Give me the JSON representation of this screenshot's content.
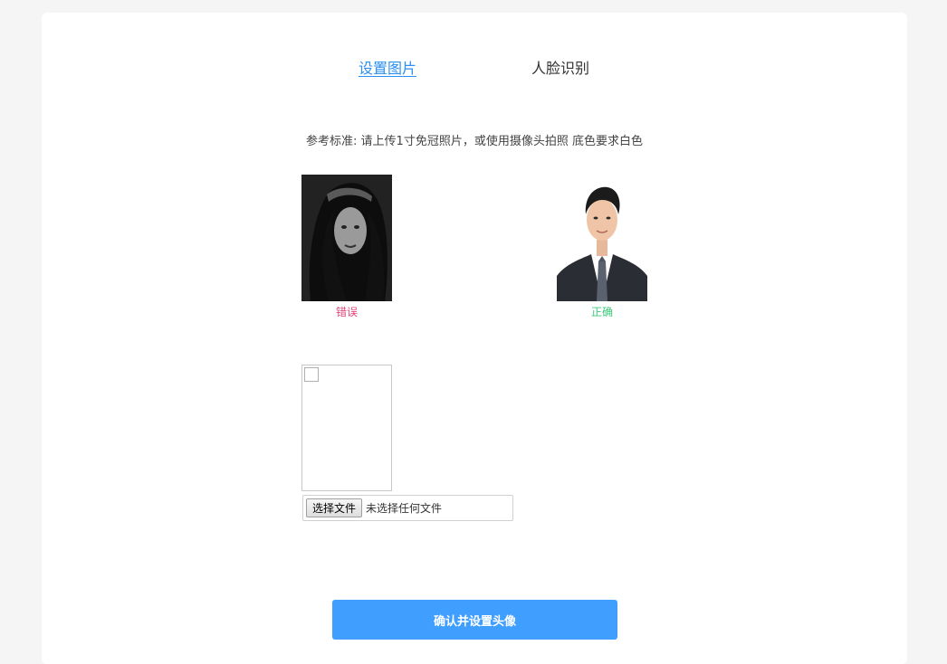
{
  "tabs": [
    {
      "label": "设置图片",
      "active": true
    },
    {
      "label": "人脸识别",
      "active": false
    }
  ],
  "hint": "参考标准: 请上传1寸免冠照片，或使用摄像头拍照 底色要求白色",
  "samples": {
    "wrong": {
      "caption": "错误",
      "color": "#e0457b"
    },
    "correct": {
      "caption": "正确",
      "color": "#3cc87a"
    }
  },
  "upload": {
    "button_label": "选择文件",
    "status": "未选择任何文件"
  },
  "confirm_label": "确认并设置头像",
  "colors": {
    "accent": "#2b8ff0",
    "primary_button": "#409eff",
    "page_bg": "#f5f5f5"
  }
}
